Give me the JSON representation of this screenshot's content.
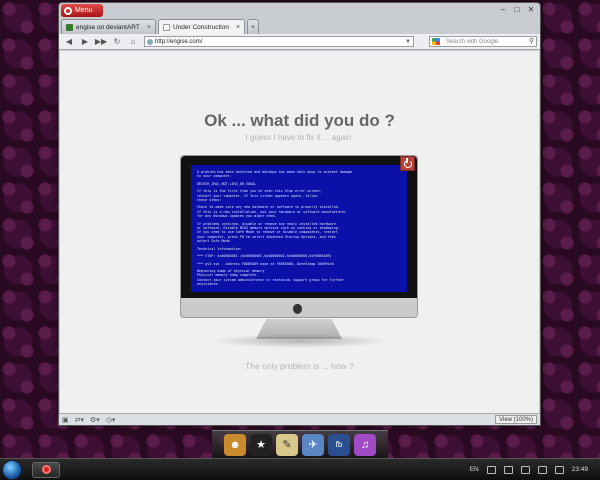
{
  "browser": {
    "menu_label": "Menu",
    "tabs": [
      {
        "label": "engise on deviantART"
      },
      {
        "label": "Under Construction"
      }
    ],
    "url": "http://engise.com/",
    "search_placeholder": "Search with Google",
    "zoom_label": "View (100%)"
  },
  "page": {
    "headline": "Ok ... what did you do ?",
    "subline": "I guess I have to fix it ... again.",
    "footer": "The only problem is ... how ?",
    "bsod_lines": [
      "A problem has been detected and Windows has been shut down to prevent damage",
      "to your computer.",
      "",
      "DRIVER_IRQL_NOT_LESS_OR_EQUAL",
      "",
      "If this is the first time you've seen this Stop error screen,",
      "restart your computer. If this screen appears again, follow",
      "these steps:",
      "",
      "Check to make sure any new hardware or software is properly installed.",
      "If this is a new installation, ask your hardware or software manufacturer",
      "for any Windows updates you might need.",
      "",
      "If problems continue, disable or remove any newly installed hardware",
      "or software. Disable BIOS memory options such as caching or shadowing.",
      "If you need to use Safe Mode to remove or disable components, restart",
      "your computer, press F8 to select Advanced Startup Options, and then",
      "select Safe Mode.",
      "",
      "Technical information:",
      "",
      "*** STOP: 0x000000D1 (0x0000000C,0x00000002,0x00000000,0xF86B5A89)",
      "",
      "***       gv3.sys - Address F86B5A89 base at F86B5000, DateStamp 3dd991eb",
      "",
      "Beginning dump of physical memory",
      "Physical memory dump complete.",
      "Contact your system administrator or technical support group for further",
      "assistance."
    ]
  },
  "taskbar": {
    "language": "EN",
    "clock": "23:49"
  },
  "colors": {
    "bsod_blue": "#0a10a8",
    "power_red": "#b5433a",
    "opera_red": "#d22222"
  }
}
